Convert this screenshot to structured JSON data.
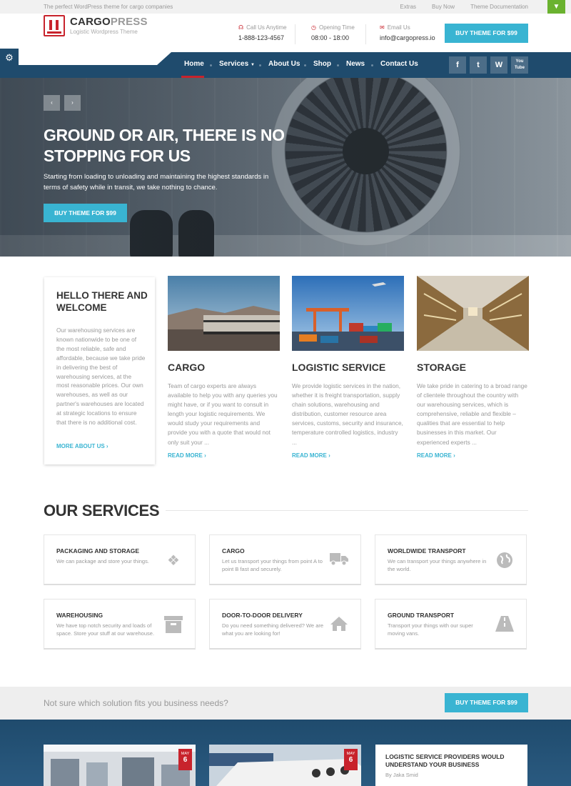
{
  "topbar": {
    "tagline": "The perfect WordPress theme for cargo companies",
    "links": [
      "Extras",
      "Buy Now",
      "Theme Documentation"
    ]
  },
  "header": {
    "logo_main": "CARGO",
    "logo_accent": "PRESS",
    "logo_sub": "Logistic Wordpress Theme",
    "call_label": "Call Us Anytime",
    "call_value": "1-888-123-4567",
    "hours_label": "Opening Time",
    "hours_value": "08:00 - 18:00",
    "email_label": "Email Us",
    "email_value": "info@cargopress.io",
    "buy_button": "BUY THEME FOR $99"
  },
  "nav": {
    "items": [
      "Home",
      "Services",
      "About Us",
      "Shop",
      "News",
      "Contact Us"
    ],
    "active": "Home",
    "social": [
      "f",
      "t",
      "W",
      "You Tube"
    ]
  },
  "hero": {
    "title": "GROUND OR AIR, THERE IS NO STOPPING FOR US",
    "text": "Starting from loading to unloading and maintaining the highest standards in terms of safety while in transit, we take nothing to chance.",
    "button": "BUY THEME FOR $99",
    "prev": "‹",
    "next": "›"
  },
  "welcome": {
    "title": "HELLO THERE AND WELCOME",
    "text": "Our warehousing services are known nationwide to be one of the most reliable, safe and affordable, because we take pride in delivering the best of warehousing services, at the most reasonable prices. Our own warehouses, as well as our partner's warehouses are located at strategic locations to ensure that there is no additional cost.",
    "more": "MORE ABOUT US ›"
  },
  "cards": [
    {
      "title": "CARGO",
      "text": "Team of cargo experts are always available to help you with any queries you might have, or if you want to consult in length your logistic requirements. We would study your requirements and provide you with a quote that would not only suit your ...",
      "more": "READ MORE ›"
    },
    {
      "title": "LOGISTIC SERVICE",
      "text": "We provide logistic services in the nation, whether it is freight transportation, supply chain solutions, warehousing and distribution, customer resource area services, customs, security and insurance, temperature controlled logistics, industry ...",
      "more": "READ MORE ›"
    },
    {
      "title": "STORAGE",
      "text": "We take pride in catering to a broad range of clientele throughout the country with our warehousing services, which is comprehensive, reliable and flexible – qualities that are essential to help businesses in this market. Our experienced experts ...",
      "more": "READ MORE ›"
    }
  ],
  "services": {
    "heading": "OUR SERVICES",
    "items": [
      {
        "title": "PACKAGING AND STORAGE",
        "text": "We can package and store your things.",
        "icon": "dropbox-icon"
      },
      {
        "title": "CARGO",
        "text": "Let us transport your things from point A to point B fast and securely.",
        "icon": "truck-icon"
      },
      {
        "title": "WORLDWIDE TRANSPORT",
        "text": "We can transport your things anywhere in the world.",
        "icon": "globe-icon"
      },
      {
        "title": "WAREHOUSING",
        "text": "We have top notch security and loads of space. Store your stuff at our warehouse.",
        "icon": "archive-icon"
      },
      {
        "title": "DOOR-TO-DOOR DELIVERY",
        "text": "Do you need something delivered? We are what you are looking for!",
        "icon": "home-icon"
      },
      {
        "title": "GROUND TRANSPORT",
        "text": "Transport your things with our super moving vans.",
        "icon": "road-icon"
      }
    ]
  },
  "cta": {
    "text": "Not sure which solution fits you business needs?",
    "button": "BUY THEME FOR $99"
  },
  "news": {
    "items": [
      {
        "month": "MAY",
        "day": "6"
      },
      {
        "month": "MAY",
        "day": "6"
      }
    ],
    "post_title": "LOGISTIC SERVICE PROVIDERS WOULD UNDERSTAND YOUR BUSINESS",
    "post_author": "By Jaka Smid"
  },
  "colors": {
    "accent": "#39b4d2",
    "brand_red": "#c8232c",
    "nav_blue": "#1f4b6d"
  }
}
